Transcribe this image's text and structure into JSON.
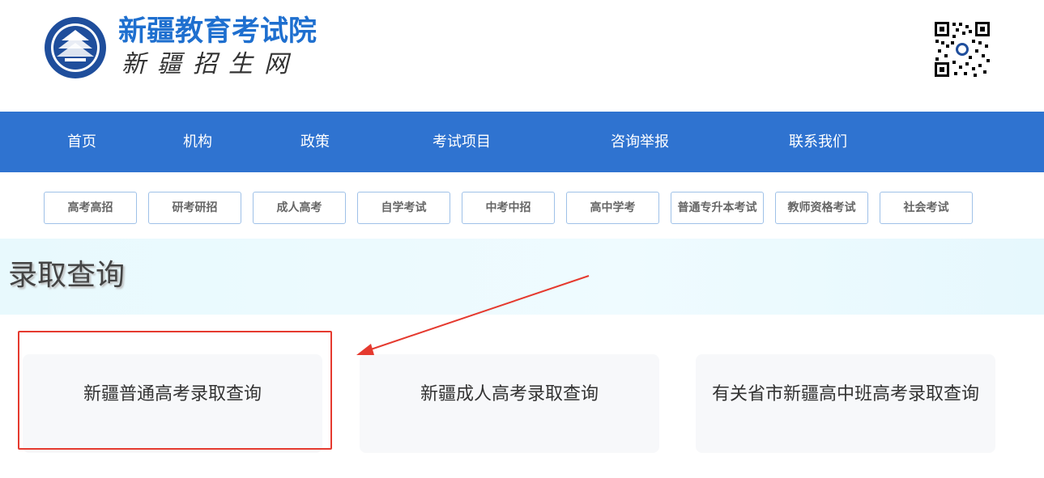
{
  "header": {
    "title": "新疆教育考试院",
    "subtitle": "新疆招生网"
  },
  "nav": {
    "items": [
      "首页",
      "机构",
      "政策",
      "考试项目",
      "咨询举报",
      "联系我们"
    ]
  },
  "sub_tabs": [
    "高考高招",
    "研考研招",
    "成人高考",
    "自学考试",
    "中考中招",
    "高中学考",
    "普通专升本考试",
    "教师资格考试",
    "社会考试"
  ],
  "section": {
    "title": "录取查询"
  },
  "cards": [
    "新疆普通高考录取查询",
    "新疆成人高考录取查询",
    "有关省市新疆高中班高考录取查询"
  ],
  "colors": {
    "nav_bg": "#2f73d0",
    "brand": "#1e6fcf",
    "annotation": "#e53a2f"
  }
}
